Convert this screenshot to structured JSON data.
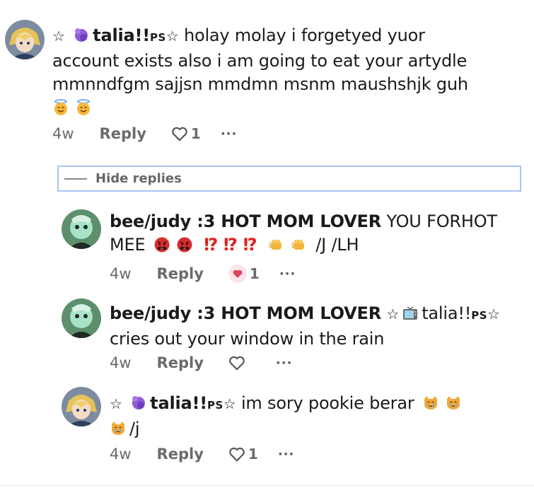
{
  "comments": [
    {
      "author_prefix": "☆",
      "author": "talia!!",
      "author_tag": "PS",
      "author_suffix": "☆",
      "line1": "holay molay i forgetyed yuor",
      "line2": "account exists also i am going to eat your artydle",
      "line3": "mmnndfgm sajjsn mmdmn msnm maushshjk guh",
      "emojis": [
        "smiling-face-with-halo",
        "smiling-face-with-halo"
      ],
      "time": "4w",
      "reply_label": "Reply",
      "like_count": "1",
      "more_label": "···"
    }
  ],
  "replies_toggle": {
    "label": "Hide replies"
  },
  "replies": [
    {
      "author": "bee/judy :3 HOT MOM LOVER",
      "line1": "YOU FORHOT",
      "line2_start": "MEE",
      "marks": [
        "⁉",
        "⁉",
        "⁉"
      ],
      "line2_end": "/J /LH",
      "emojis": [
        "angry-face-with-symbols",
        "angry-face-with-symbols",
        "oncoming-fist",
        "oncoming-fist"
      ],
      "time": "4w",
      "reply_label": "Reply",
      "like_count": "1",
      "more_label": "···"
    },
    {
      "author": "bee/judy :3 HOT MOM LOVER",
      "mention_prefix": "☆",
      "mention": "talia!!",
      "mention_tag": "PS",
      "mention_suffix": "☆",
      "line2": "cries out your window in the rain",
      "time": "4w",
      "reply_label": "Reply",
      "more_label": "···"
    },
    {
      "author_prefix": "☆",
      "author": "talia!!",
      "author_tag": "PS",
      "author_suffix": "☆",
      "line1": "im sory pookie berar",
      "line2_end": "/j",
      "emojis": [
        "crying-cat",
        "crying-cat",
        "crying-cat"
      ],
      "time": "4w",
      "reply_label": "Reply",
      "like_count": "1",
      "more_label": "···"
    }
  ],
  "colors": {
    "accent_border": "#a9c4f5",
    "muted_text": "#6b6b6b",
    "liked_heart": "#e0435c"
  }
}
